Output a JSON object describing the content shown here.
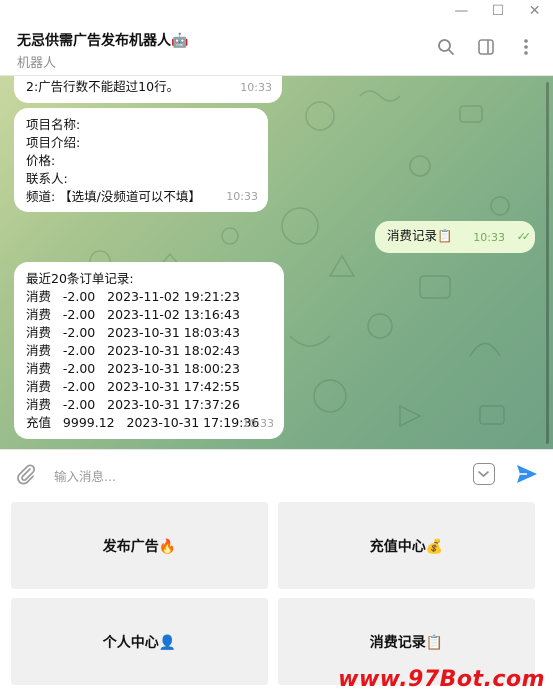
{
  "window": {
    "minimize": "—",
    "maximize": "☐",
    "close": "✕"
  },
  "header": {
    "title": "无忌供需广告发布机器人🤖",
    "subtitle": "机器人",
    "icons": [
      "search-icon",
      "sidebar-toggle-icon",
      "more-vert-icon"
    ]
  },
  "messages": [
    {
      "type": "incoming",
      "text": "2:广告行数不能超过10行。",
      "time": "10:33"
    },
    {
      "type": "incoming",
      "lines": [
        "项目名称:",
        "项目介绍:",
        "价格:",
        "联系人:",
        "频道: 【选填/没频道可以不填】"
      ],
      "time": "10:33"
    },
    {
      "type": "outgoing",
      "text": "消费记录📋",
      "time": "10:33",
      "status": "read"
    },
    {
      "type": "incoming",
      "lines": [
        "最近20条订单记录:",
        "消费   -2.00   2023-11-02 19:21:23",
        "消费   -2.00   2023-11-02 13:16:43",
        "消费   -2.00   2023-10-31 18:03:43",
        "消费   -2.00   2023-10-31 18:02:43",
        "消费   -2.00   2023-10-31 18:00:23",
        "消费   -2.00   2023-10-31 17:42:55",
        "消费   -2.00   2023-10-31 17:37:26",
        "充值   9999.12   2023-10-31 17:19:36"
      ],
      "time": "10:33"
    }
  ],
  "composer": {
    "placeholder": "输入消息..."
  },
  "keyboard": {
    "buttons": [
      "发布广告🔥",
      "充值中心💰",
      "个人中心👤",
      "消费记录📋"
    ]
  },
  "watermark": "www.97Bot.com",
  "colors": {
    "accent": "#3390ec",
    "outgoing_bubble": "#eaf8d6",
    "watermark": "#e4141b"
  }
}
